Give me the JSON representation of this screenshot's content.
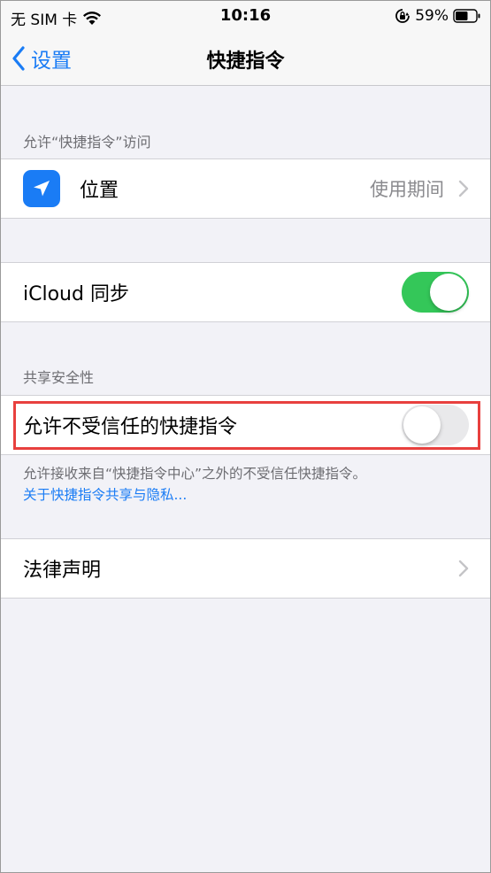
{
  "status_bar": {
    "carrier": "无 SIM 卡",
    "time": "10:16",
    "battery": "59%"
  },
  "nav": {
    "back_label": "设置",
    "title": "快捷指令"
  },
  "sections": {
    "access_header": "允许“快捷指令”访问",
    "location_label": "位置",
    "location_value": "使用期间",
    "icloud_label": "iCloud 同步",
    "icloud_on": true,
    "sharing_header": "共享安全性",
    "untrusted_label": "允许不受信任的快捷指令",
    "untrusted_on": false,
    "untrusted_footer": "允许接收来自“快捷指令中心”之外的不受信任快捷指令。",
    "privacy_link": "关于快捷指令共享与隐私...",
    "legal_label": "法律声明"
  },
  "colors": {
    "accent": "#1a7cf5",
    "toggle_on": "#34c759",
    "highlight": "#e8403e"
  },
  "icons": [
    "wifi-icon",
    "orientation-lock-icon",
    "battery-icon",
    "back-chevron-icon",
    "location-arrow-icon",
    "chevron-right-icon"
  ]
}
